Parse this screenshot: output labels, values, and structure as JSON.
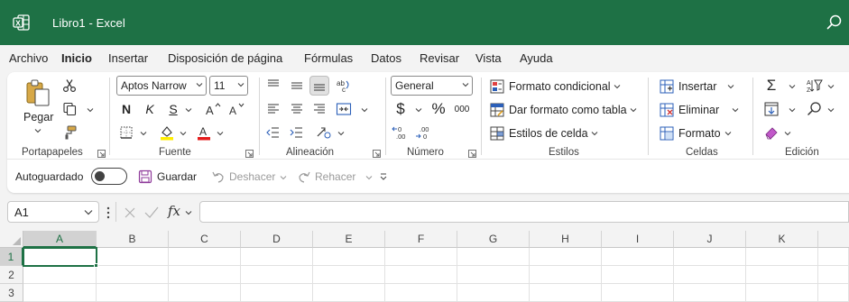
{
  "window": {
    "title": "Libro1  -  Excel",
    "brand_color": "#1e7145"
  },
  "menu": {
    "tabs": [
      {
        "label": "Archivo"
      },
      {
        "label": "Inicio",
        "active": true
      },
      {
        "label": "Insertar"
      },
      {
        "label": "Disposición de página"
      },
      {
        "label": "Fórmulas"
      },
      {
        "label": "Datos"
      },
      {
        "label": "Revisar"
      },
      {
        "label": "Vista"
      },
      {
        "label": "Ayuda"
      }
    ]
  },
  "ribbon": {
    "groups": {
      "clipboard": {
        "label": "Portapapeles",
        "paste_label": "Pegar"
      },
      "font": {
        "label": "Fuente",
        "font_name": "Aptos Narrow",
        "font_size": "11",
        "bold": "N",
        "italic": "K",
        "underline": "S"
      },
      "alignment": {
        "label": "Alineación"
      },
      "number": {
        "label": "Número",
        "format": "General",
        "currency": "$",
        "percent": "%",
        "thousands": "000"
      },
      "styles": {
        "label": "Estilos",
        "conditional": "Formato condicional",
        "as_table": "Dar formato como tabla",
        "cell_styles": "Estilos de celda"
      },
      "cells": {
        "label": "Celdas",
        "insert": "Insertar",
        "delete": "Eliminar",
        "format": "Formato"
      },
      "editing": {
        "label": "Edición"
      }
    }
  },
  "qat": {
    "autosave": "Autoguardado",
    "save": "Guardar",
    "undo": "Deshacer",
    "redo": "Rehacer"
  },
  "formula_bar": {
    "name_box": "A1",
    "fx": "fx",
    "formula": ""
  },
  "grid": {
    "columns": [
      "A",
      "B",
      "C",
      "D",
      "E",
      "F",
      "G",
      "H",
      "I",
      "J",
      "K"
    ],
    "rows": [
      "1",
      "2",
      "3"
    ],
    "active_cell": "A1"
  }
}
